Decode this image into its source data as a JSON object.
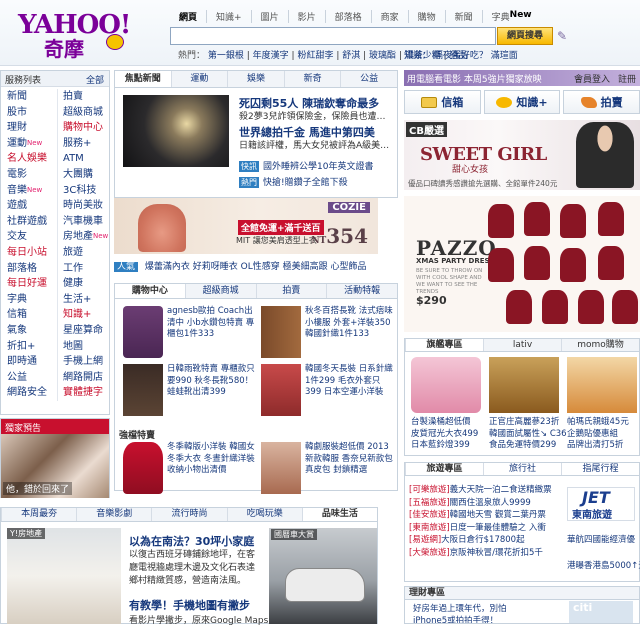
{
  "header": {
    "logo": "YAHOO!",
    "logo_sub": "奇摩",
    "tabs": [
      "網頁",
      "知識+",
      "圖片",
      "影片",
      "部落格",
      "商家",
      "購物",
      "新聞",
      "字典"
    ],
    "tab_new_index": 8,
    "search_value": "",
    "search_button": "網頁搜尋",
    "hot_label": "熱門：",
    "hot_links": [
      "第一銀根",
      "年度漢字",
      "粉紅甜李",
      "舒淇",
      "玻璃酯",
      "濃茶少糖",
      "猜品"
    ],
    "knowledge_label": "知識：",
    "knowledge_links": [
      "隔夜蛋好吃？",
      "滿瑄面"
    ]
  },
  "sidebar": {
    "title": "服務列表",
    "all_label": "全部",
    "col1": [
      {
        "label": "新聞",
        "new": false,
        "red": false
      },
      {
        "label": "股市",
        "new": false,
        "red": false
      },
      {
        "label": "理財",
        "new": false,
        "red": false
      },
      {
        "label": "運動",
        "new": true,
        "red": false
      },
      {
        "label": "名人娛樂",
        "new": false,
        "red": true
      },
      {
        "label": "電影",
        "new": false,
        "red": false
      },
      {
        "label": "音樂",
        "new": true,
        "red": false
      },
      {
        "label": "遊戲",
        "new": false,
        "red": false
      },
      {
        "label": "社群遊戲",
        "new": false,
        "red": false
      },
      {
        "label": "交友",
        "new": false,
        "red": false
      },
      {
        "label": "每日小站",
        "new": false,
        "red": true
      },
      {
        "label": "部落格",
        "new": false,
        "red": false
      },
      {
        "label": "每日好運",
        "new": false,
        "red": true
      },
      {
        "label": "字典",
        "new": false,
        "red": false
      },
      {
        "label": "信箱",
        "new": false,
        "red": false
      },
      {
        "label": "氣象",
        "new": false,
        "red": false
      },
      {
        "label": "折扣+",
        "new": false,
        "red": false
      },
      {
        "label": "即時通",
        "new": false,
        "red": false
      },
      {
        "label": "公益",
        "new": false,
        "red": false
      },
      {
        "label": "網路安全",
        "new": false,
        "red": false
      }
    ],
    "col2": [
      {
        "label": "拍賣",
        "new": false,
        "red": false
      },
      {
        "label": "超級商城",
        "new": false,
        "red": false
      },
      {
        "label": "購物中心",
        "new": false,
        "red": true
      },
      {
        "label": "服務+",
        "new": false,
        "red": false
      },
      {
        "label": "ATM",
        "new": false,
        "red": false
      },
      {
        "label": "大團購",
        "new": false,
        "red": false
      },
      {
        "label": "3C科技",
        "new": false,
        "red": false
      },
      {
        "label": "時尚美妝",
        "new": false,
        "red": false
      },
      {
        "label": "汽車機車",
        "new": false,
        "red": false
      },
      {
        "label": "房地產",
        "new": true,
        "red": false
      },
      {
        "label": "旅遊",
        "new": false,
        "red": false
      },
      {
        "label": "工作",
        "new": false,
        "red": false
      },
      {
        "label": "健康",
        "new": false,
        "red": false
      },
      {
        "label": "生活+",
        "new": false,
        "red": false
      },
      {
        "label": "知識+",
        "new": false,
        "red": true
      },
      {
        "label": "星座算命",
        "new": false,
        "red": false
      },
      {
        "label": "地圖",
        "new": false,
        "red": false
      },
      {
        "label": "手機上網",
        "new": false,
        "red": false
      },
      {
        "label": "網路開店",
        "new": false,
        "red": false
      },
      {
        "label": "實體捷字",
        "new": false,
        "red": true
      }
    ]
  },
  "promo_left": {
    "title": "獨家預告",
    "caption": "他，錯於回來了"
  },
  "news": {
    "tabs": [
      "焦點新聞",
      "運動",
      "娛樂",
      "新奇",
      "公益"
    ],
    "headline1": "死囚剩55人 陳瑞欽奪命最多",
    "sub1": "殺2夢3兒詐領保險金，保險員也遭…",
    "headline2": "世界總拍千金 馬進中第四美",
    "sub2": "日籍該評權，馬大女兒被評為A級美…",
    "rows": [
      {
        "tag": "快訊",
        "text": "國外睡辨公學10年英文證書"
      },
      {
        "tag": "熱門",
        "text": "快搶!贈鑽子全館下殺"
      }
    ]
  },
  "cozie": {
    "badge": "全館免運+滿千送百",
    "sub": "MIT 讓您美肩透型上衣",
    "brand": "COZIE",
    "currency": "NT",
    "price": "354"
  },
  "hotbar": {
    "tag": "人氣",
    "links": [
      "爆蕾滿內衣",
      "好莉呀睡衣",
      "OL性感穿",
      "極美細高跟",
      "心型飾品"
    ]
  },
  "shop": {
    "tabs": [
      "購物中心",
      "超級商城",
      "拍賣",
      "活動特報"
    ],
    "products": [
      {
        "text": "agnesb歐拍 Coach出清中 小b水鑽包特賣 專櫃包1件333"
      },
      {
        "text": "秋冬百搭長靴 法式痞味小樓服 外套+洋裝350 韓國針織1件133"
      },
      {
        "text": "日韓雨靴特賣 專櫃款只要990 秋冬長靴580！ 蛙蛙靴出清399"
      },
      {
        "text": "韓國冬天長裝 日系針織1件299 毛衣外套只399 日本空運小洋裝"
      }
    ],
    "special_title": "強檔特賣",
    "special": [
      {
        "text": "冬季韓版小洋裝 韓國女冬季大衣 冬晝針織洋裝 收納小物出清價"
      },
      {
        "text": "韓劇服裝超低價 2013新款韓服 香奈兒新款包 真皮包 封鎖精選"
      }
    ]
  },
  "bottom": {
    "tabs": [
      "本周最夯",
      "音樂影劇",
      "流行時尚",
      "吃喝玩樂",
      "品味生活"
    ],
    "img1_label": "Y!房地產",
    "headline1": "以為在南法？30坪小家庭",
    "text1": "以復古西班牙磚鋪餘地坪，在客廳電視牆處理木邊及文化石表達鄉村精緻質感，營造南法風。",
    "headline2": "有教學！手機地圖有撇步",
    "text2": "看影片學撇步，原來Google Maps",
    "img2_label": "國曆車大賞"
  },
  "right": {
    "promo_text": "用電腦看電影 本周5強片獨家放映",
    "login": "會員登入",
    "register": "註冊",
    "buttons": [
      "信箱",
      "知識+",
      "拍賣"
    ],
    "ad1": {
      "brand": "CB嚴選",
      "title": "SWEET GIRL",
      "sub": "甜心女孩",
      "note": "優品口碑讀秀感讚搶先選購、全館單件240元"
    },
    "ad2": {
      "brand": "PAZZO",
      "sub": "XMAS PARTY DRESS",
      "small": "BE SURE TO THROW ON WITH COOL SHAPE AND WE WANT TO SEE THE TRENDS",
      "price": "$290"
    },
    "brand_box": {
      "tabs": [
        "旗艦專區",
        "lativ",
        "momo購物"
      ],
      "links": [
        "台製澡桶超低價",
        "皮質冠光大衣499",
        "日本藍鈴燈399",
        "正官庄高麗蔘23折",
        "韓國面試屬性↘ C36",
        "食品免運特價299",
        "帕瑪氏親蛾45元",
        "企鵝貼優惠組",
        "品牌出清打5折"
      ]
    },
    "travel": {
      "tabs": [
        "旅遊專區",
        "旅行社",
        "指尾行程"
      ],
      "items": [
        {
          "tag": "[可樂旅遊]",
          "text": "義大天院一泊二食送精緻票"
        },
        {
          "tag": "[五福旅遊]",
          "text": "關西住溫泉旅人9999"
        },
        {
          "tag": "[佳安旅遊]",
          "text": "韓國地天雪 觀賞二葉丹票"
        },
        {
          "tag": "[東南旅遊]",
          "text": "日度一筆最佳體驗之 入衝"
        },
        {
          "tag": "[易遊網]",
          "text": "大阪日倉行$17800起"
        },
        {
          "tag": "[大榮旅遊]",
          "text": "京阪神秋冒/環花折扣5千"
        }
      ],
      "jet": "JET",
      "jet_sub": "東南旅遊",
      "jet_text1": "華航四國能經濟優",
      "jet_text2": "港曝香港島5000↑元"
    },
    "finance": {
      "title": "理財專區",
      "line1": "好房年過上環年代，別怕",
      "line2": "iPhone5或拍拍手得！"
    }
  }
}
